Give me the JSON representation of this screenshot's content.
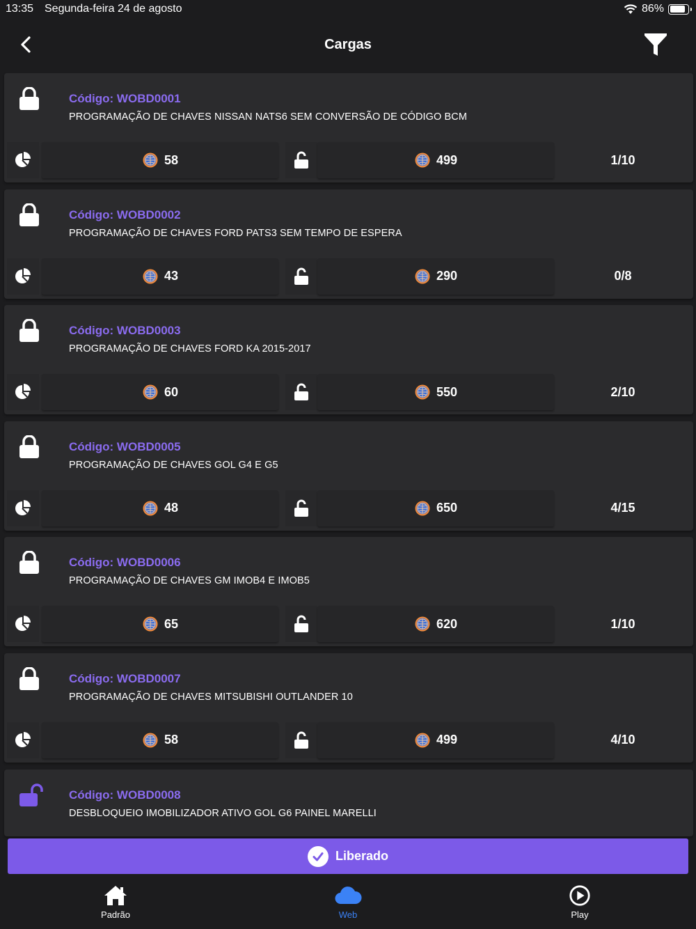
{
  "status": {
    "time": "13:35",
    "date": "Segunda-feira 24 de agosto",
    "battery": "86%",
    "battery_level": 0.86
  },
  "nav": {
    "title": "Cargas",
    "back_icon": "chevron-left-icon",
    "filter_icon": "filter-icon"
  },
  "colors": {
    "accent": "#7c5ae8",
    "code_text": "#8b6cf0",
    "card_bg": "#2b2b2d",
    "page_bg": "#1c1c1e"
  },
  "cargas": [
    {
      "code": "Código: WOBD0001",
      "desc": "PROGRAMAÇÃO DE CHAVES NISSAN NATS6 SEM CONVERSÃO DE CÓDIGO BCM",
      "locked": true,
      "stat1": "58",
      "stat2": "499",
      "ratio": "1/10"
    },
    {
      "code": "Código: WOBD0002",
      "desc": "PROGRAMAÇÃO DE CHAVES FORD PATS3 SEM TEMPO DE ESPERA",
      "locked": true,
      "stat1": "43",
      "stat2": "290",
      "ratio": "0/8"
    },
    {
      "code": "Código: WOBD0003",
      "desc": "PROGRAMAÇÃO DE CHAVES FORD KA 2015-2017",
      "locked": true,
      "stat1": "60",
      "stat2": "550",
      "ratio": "2/10"
    },
    {
      "code": "Código: WOBD0005",
      "desc": "PROGRAMAÇÃO DE CHAVES GOL G4 E G5",
      "locked": true,
      "stat1": "48",
      "stat2": "650",
      "ratio": "4/15"
    },
    {
      "code": "Código: WOBD0006",
      "desc": "PROGRAMAÇÃO DE CHAVES GM IMOB4 E IMOB5",
      "locked": true,
      "stat1": "65",
      "stat2": "620",
      "ratio": "1/10"
    },
    {
      "code": "Código: WOBD0007",
      "desc": "PROGRAMAÇÃO DE CHAVES MITSUBISHI OUTLANDER 10",
      "locked": true,
      "stat1": "58",
      "stat2": "499",
      "ratio": "4/10"
    },
    {
      "code": "Código: WOBD0008",
      "desc": "DESBLOQUEIO IMOBILIZADOR ATIVO GOL G6 PAINEL MARELLI",
      "locked": false
    }
  ],
  "action": {
    "label": "Liberado",
    "icon": "check-circle-icon"
  },
  "tabs": [
    {
      "label": "Padrão",
      "icon": "home-icon",
      "active": false
    },
    {
      "label": "Web",
      "icon": "cloud-icon",
      "active": true
    },
    {
      "label": "Play",
      "icon": "play-circle-icon",
      "active": false
    }
  ]
}
